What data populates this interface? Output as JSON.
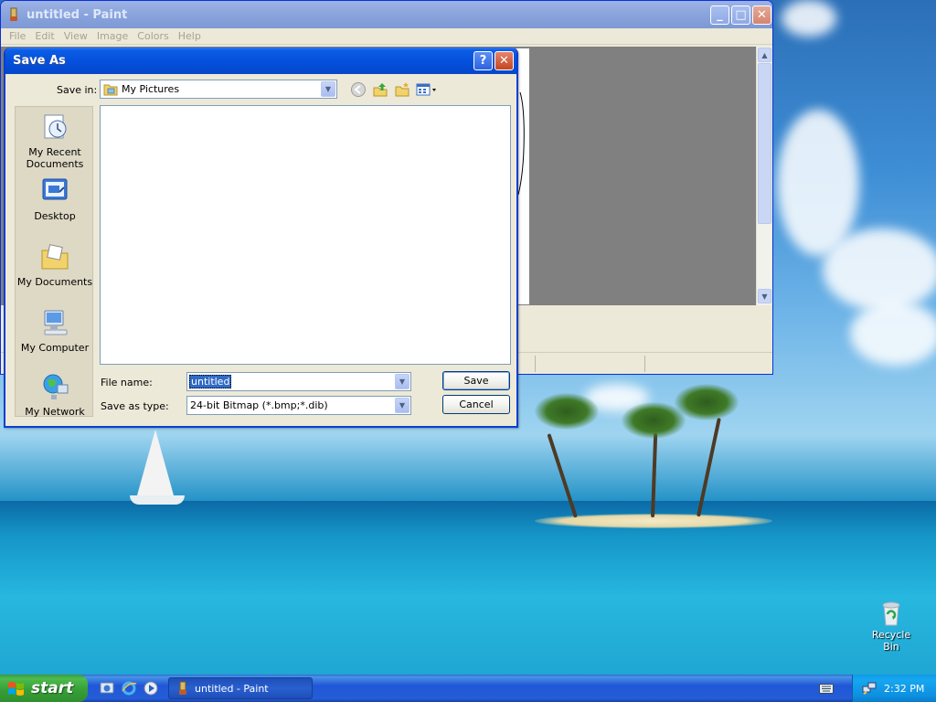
{
  "paint_window": {
    "title": "untitled - Paint",
    "menu": [
      "File",
      "Edit",
      "View",
      "Image",
      "Colors",
      "Help"
    ],
    "controls": {
      "minimize": "_",
      "maximize": "□",
      "close": "✕"
    }
  },
  "dialog": {
    "title": "Save As",
    "help_label": "?",
    "close_label": "✕",
    "save_in_label": "Save in:",
    "save_in_value": "My Pictures",
    "places": [
      {
        "label": "My Recent\nDocuments",
        "icon": "recent-documents-icon"
      },
      {
        "label": "Desktop",
        "icon": "desktop-icon"
      },
      {
        "label": "My Documents",
        "icon": "my-documents-icon"
      },
      {
        "label": "My Computer",
        "icon": "my-computer-icon"
      },
      {
        "label": "My Network",
        "icon": "my-network-icon"
      }
    ],
    "file_name_label": "File name:",
    "file_name_value": "untitled",
    "save_type_label": "Save as type:",
    "save_type_value": "24-bit Bitmap (*.bmp;*.dib)",
    "save_button": "Save",
    "cancel_button": "Cancel"
  },
  "desktop": {
    "recycle_bin_label": "Recycle Bin"
  },
  "taskbar": {
    "start_label": "start",
    "task_label": "untitled - Paint",
    "clock": "2:32 PM"
  }
}
